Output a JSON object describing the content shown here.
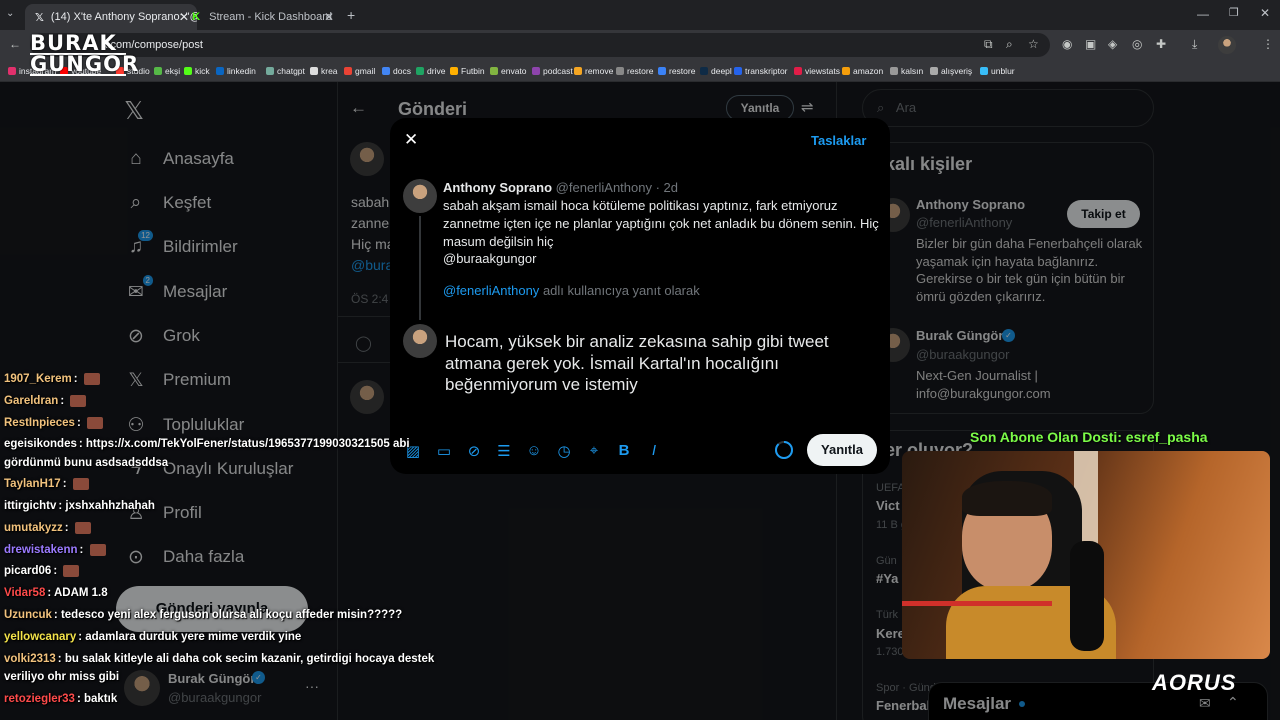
{
  "browser": {
    "tabs": [
      {
        "label": "(14) X'te Anthony Soprano: \"@...",
        "icon": "x-logo-icon"
      },
      {
        "label": "Stream - Kick Dashboard",
        "icon": "kick-icon"
      }
    ],
    "url": "x.com/compose/post",
    "bookmarks": [
      "instagram",
      "youtube",
      "studio",
      "ekşi",
      "kick",
      "linkedin",
      "chatgpt",
      "krea",
      "gmail",
      "docs",
      "drive",
      "Futbin",
      "envato",
      "podcast",
      "remove",
      "restore",
      "restore",
      "deepl",
      "transkriptor",
      "viewstats",
      "amazon",
      "kalsın",
      "alışveriş",
      "unblur"
    ]
  },
  "overlay_logo": {
    "line1": "BURAK",
    "line2": "GUNGOR"
  },
  "x_nav": {
    "items": [
      {
        "label": "Anasayfa",
        "icon": "home-icon"
      },
      {
        "label": "Keşfet",
        "icon": "search-icon"
      },
      {
        "label": "Bildirimler",
        "icon": "bell-icon",
        "badge": "12"
      },
      {
        "label": "Mesajlar",
        "icon": "mail-icon",
        "badge": "2"
      },
      {
        "label": "Grok",
        "icon": "grok-icon"
      },
      {
        "label": "Premium",
        "icon": "x-logo-icon"
      },
      {
        "label": "Topluluklar",
        "icon": "people-icon"
      },
      {
        "label": "Onaylı Kuruluşlar",
        "icon": "lightning-icon"
      },
      {
        "label": "Profil",
        "icon": "person-icon"
      },
      {
        "label": "Daha fazla",
        "icon": "more-circle-icon"
      }
    ],
    "post_button": "Gönderi yayınla",
    "account": {
      "name": "Burak Güngör",
      "handle": "@buraakgungor"
    }
  },
  "main": {
    "title": "Gönderi",
    "reply_button": "Yanıtla",
    "tweet_fragments": [
      "sabah",
      "zanne",
      "Hiç ma",
      "@bura"
    ],
    "time_fragment": "ÖS 2:4"
  },
  "search": {
    "placeholder": "Ara"
  },
  "related": {
    "title": "lakalı kişiler",
    "people": [
      {
        "name": "Anthony Soprano",
        "handle": "@fenerliAnthony",
        "bio": "Bizler bir gün daha Fenerbahçeli olarak yaşamak için hayata bağlanırız. Gerekirse o bir tek gün için bütün bir ömrü gözden çıkarırız.",
        "follow": "Takip et"
      },
      {
        "name": "Burak Güngör",
        "handle": "@buraakgungor",
        "bio": "Next-Gen Journalist | info@burakgungor.com"
      }
    ]
  },
  "trends": {
    "title": "eler oluyor?",
    "items": [
      {
        "meta": "UEFA",
        "title": "Vict",
        "count": "11 B g"
      },
      {
        "meta": "Gün",
        "title": "#Ya"
      },
      {
        "meta": "Türk",
        "title": "Kere",
        "count": "1.730 gö"
      },
      {
        "meta": "Spor · Günd",
        "title": "Fenerbah"
      }
    ]
  },
  "messages_dock": {
    "label": "Mesajlar"
  },
  "modal": {
    "drafts": "Taslaklar",
    "quoted": {
      "name": "Anthony Soprano",
      "handle": "@fenerliAnthony",
      "time": "· 2d",
      "text": "sabah akşam ismail hoca kötüleme politikası yaptınız, fark etmiyoruz zannetme içten içe ne planlar yaptığını çok net anladık bu dönem senin. Hiç masum değilsin hiç",
      "mention": "@buraakgungor"
    },
    "reply_to_handle": "@fenerliAnthony",
    "reply_to_suffix": "adlı kullanıcıya yanıt olarak",
    "draft_text": "Hocam, yüksek bir analiz zekasına sahip gibi tweet atmana gerek yok. İsmail Kartal'ın hocalığını beğenmiyorum ve istemiy",
    "reply_button": "Yanıtla",
    "toolbar_icons": [
      "image-icon",
      "gif-icon",
      "grok-icon",
      "poll-icon",
      "emoji-icon",
      "schedule-icon",
      "location-icon",
      "bold-icon",
      "italic-icon"
    ]
  },
  "stream": {
    "subscriber_banner": "Son Abone Olan Dosti: esref_pasha",
    "brand": "AORUS",
    "chat": [
      {
        "user": "1907_Kerem",
        "text": "",
        "user_color": "#f1c27d"
      },
      {
        "user": "Gareldran",
        "text": "",
        "user_color": "#f1c27d"
      },
      {
        "user": "RestInpieces",
        "text": "",
        "user_color": "#f1c27d"
      },
      {
        "user": "egeisikondes",
        "text": "https://x.com/TekYolFener/status/1965377199030321505 abi",
        "user_color": "#ffffff"
      },
      {
        "user": "",
        "text": "gördünmü bunu asdsadsddsa",
        "user_color": "#ffffff"
      },
      {
        "user": "TaylanH17",
        "text": "",
        "user_color": "#f1c27d"
      },
      {
        "user": "ittirgichtv",
        "text": "jxshxahhzhahah",
        "user_color": "#ffffff"
      },
      {
        "user": "umutakyzz",
        "text": "",
        "user_color": "#f1c27d"
      },
      {
        "user": "drewistakenn",
        "text": "",
        "user_color": "#9b7bff"
      },
      {
        "user": "picard06",
        "text": "",
        "user_color": "#ffffff"
      },
      {
        "user": "Vidar58",
        "text": "ADAM 1.8",
        "user_color": "#ff4b4b"
      },
      {
        "user": "Uzuncuk",
        "text": "tedesco yeni alex ferguson olursa ali koçu affeder misin?????",
        "user_color": "#f1c27d"
      },
      {
        "user": "yellowcanary",
        "text": "adamlara durduk yere mime verdik yine",
        "user_color": "#f3e34a"
      },
      {
        "user": "volki2313",
        "text": "bu salak kitleyle ali daha cok secim kazanir, getirdigi hocaya destek",
        "user_color": "#f1c27d"
      },
      {
        "user": "",
        "text": "veriliyo ohr miss gibi",
        "user_color": "#ffffff"
      },
      {
        "user": "retoziegler33",
        "text": "baktık",
        "user_color": "#ff4b4b"
      }
    ]
  },
  "colors": {
    "accent": "#1d9bf0",
    "sub_banner": "#7cfc48",
    "bg": "#000000"
  }
}
